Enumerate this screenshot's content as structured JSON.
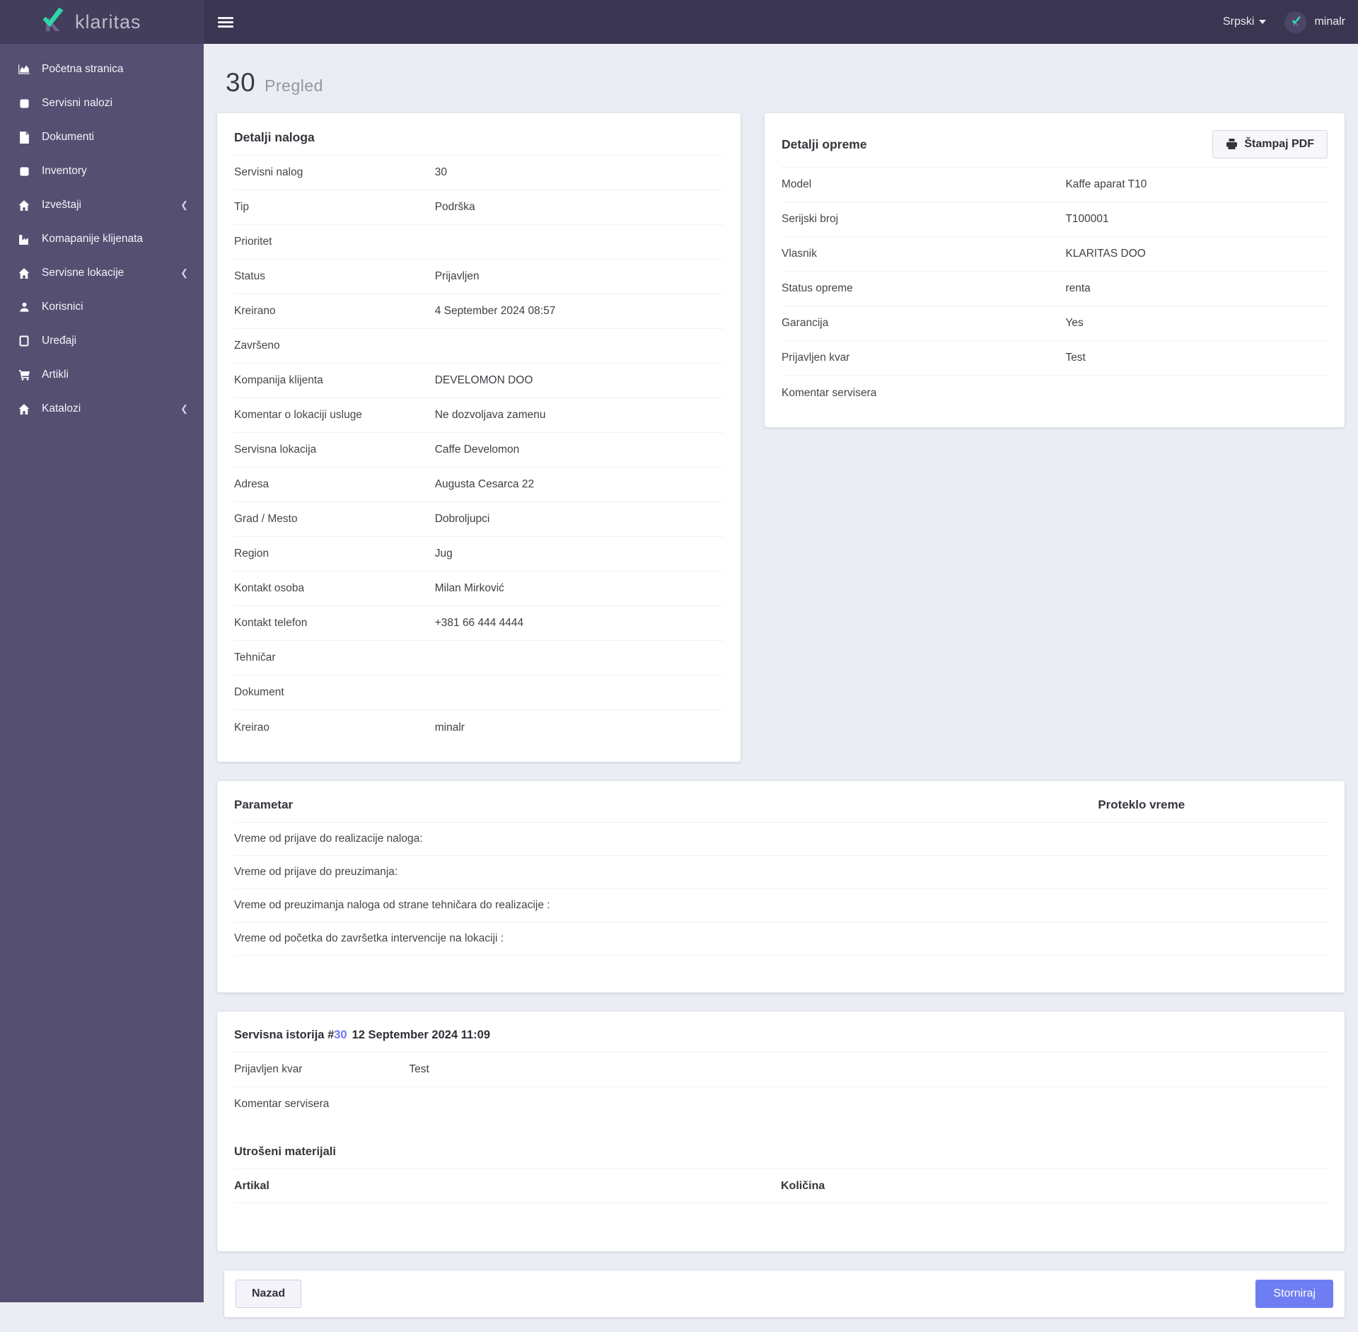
{
  "brand": {
    "name": "klaritas"
  },
  "navbar": {
    "language": "Srpski",
    "username": "minalr"
  },
  "colors": {
    "accent_teal": "#2fd7a8",
    "primary_indigo": "#6e7ef2",
    "navbar_bg": "#3a3651",
    "sidebar_bg": "#554f72",
    "page_bg": "#ebedf4"
  },
  "sidebar": {
    "items": [
      {
        "label": "Početna stranica",
        "icon": "chart-area-icon",
        "has_submenu": false
      },
      {
        "label": "Servisni nalozi",
        "icon": "square-icon",
        "has_submenu": false
      },
      {
        "label": "Dokumenti",
        "icon": "document-icon",
        "has_submenu": false
      },
      {
        "label": "Inventory",
        "icon": "square-icon",
        "has_submenu": false
      },
      {
        "label": "Izveštaji",
        "icon": "home-icon",
        "has_submenu": true
      },
      {
        "label": "Komapanije klijenata",
        "icon": "industry-icon",
        "has_submenu": false
      },
      {
        "label": "Servisne lokacije",
        "icon": "home-icon",
        "has_submenu": true
      },
      {
        "label": "Korisnici",
        "icon": "user-icon",
        "has_submenu": false
      },
      {
        "label": "Uređaji",
        "icon": "tablet-icon",
        "has_submenu": false
      },
      {
        "label": "Artikli",
        "icon": "cart-icon",
        "has_submenu": false
      },
      {
        "label": "Katalozi",
        "icon": "home-icon",
        "has_submenu": true
      }
    ]
  },
  "page": {
    "title": "30",
    "subtitle": "Pregled"
  },
  "order_details": {
    "title": "Detalji naloga",
    "rows": [
      {
        "label": "Servisni nalog",
        "value": "30"
      },
      {
        "label": "Tip",
        "value": "Podrška"
      },
      {
        "label": "Prioritet",
        "value": ""
      },
      {
        "label": "Status",
        "value": "Prijavljen"
      },
      {
        "label": "Kreirano",
        "value": "4 September 2024 08:57"
      },
      {
        "label": "Završeno",
        "value": ""
      },
      {
        "label": "Kompanija klijenta",
        "value": "DEVELOMON DOO"
      },
      {
        "label": "Komentar o lokaciji usluge",
        "value": "Ne dozvoljava zamenu"
      },
      {
        "label": "Servisna lokacija",
        "value": "Caffe Develomon"
      },
      {
        "label": "Adresa",
        "value": "Augusta Cesarca 22"
      },
      {
        "label": "Grad / Mesto",
        "value": "Dobroljupci"
      },
      {
        "label": "Region",
        "value": "Jug"
      },
      {
        "label": "Kontakt osoba",
        "value": "Milan Mirković"
      },
      {
        "label": "Kontakt telefon",
        "value": "+381 66 444 4444"
      },
      {
        "label": "Tehničar",
        "value": ""
      },
      {
        "label": "Dokument",
        "value": ""
      },
      {
        "label": "Kreirao",
        "value": "minalr"
      }
    ]
  },
  "equipment_details": {
    "title": "Detalji opreme",
    "print_button": "Štampaj PDF",
    "rows": [
      {
        "label": "Model",
        "value": "Kaffe aparat T10"
      },
      {
        "label": "Serijski broj",
        "value": "T100001"
      },
      {
        "label": "Vlasnik",
        "value": "KLARITAS DOO"
      },
      {
        "label": "Status opreme",
        "value": "renta"
      },
      {
        "label": "Garancija",
        "value": "Yes"
      },
      {
        "label": "Prijavljen kvar",
        "value": "Test"
      },
      {
        "label": "Komentar servisera",
        "value": ""
      }
    ]
  },
  "parameters": {
    "col1_header": "Parametar",
    "col2_header": "Proteklo vreme",
    "rows": [
      {
        "label": "Vreme od prijave do realizacije naloga:",
        "value": ""
      },
      {
        "label": "Vreme od prijave do preuzimanja:",
        "value": ""
      },
      {
        "label": "Vreme od preuzimanja naloga od strane tehničara do realizacije :",
        "value": ""
      },
      {
        "label": "Vreme od početka do završetka intervencije na lokaciji :",
        "value": ""
      }
    ]
  },
  "history": {
    "title_prefix": "Servisna istorija #",
    "order_no": "30",
    "title_date": "12 September 2024 11:09",
    "rows": [
      {
        "label": "Prijavljen kvar",
        "value": "Test"
      },
      {
        "label": "Komentar servisera",
        "value": ""
      }
    ],
    "materials_title": "Utrošeni materijali",
    "materials_table": {
      "col1_header": "Artikal",
      "col2_header": "Količina"
    }
  },
  "footer": {
    "back_label": "Nazad",
    "cancel_label": "Storniraj"
  }
}
